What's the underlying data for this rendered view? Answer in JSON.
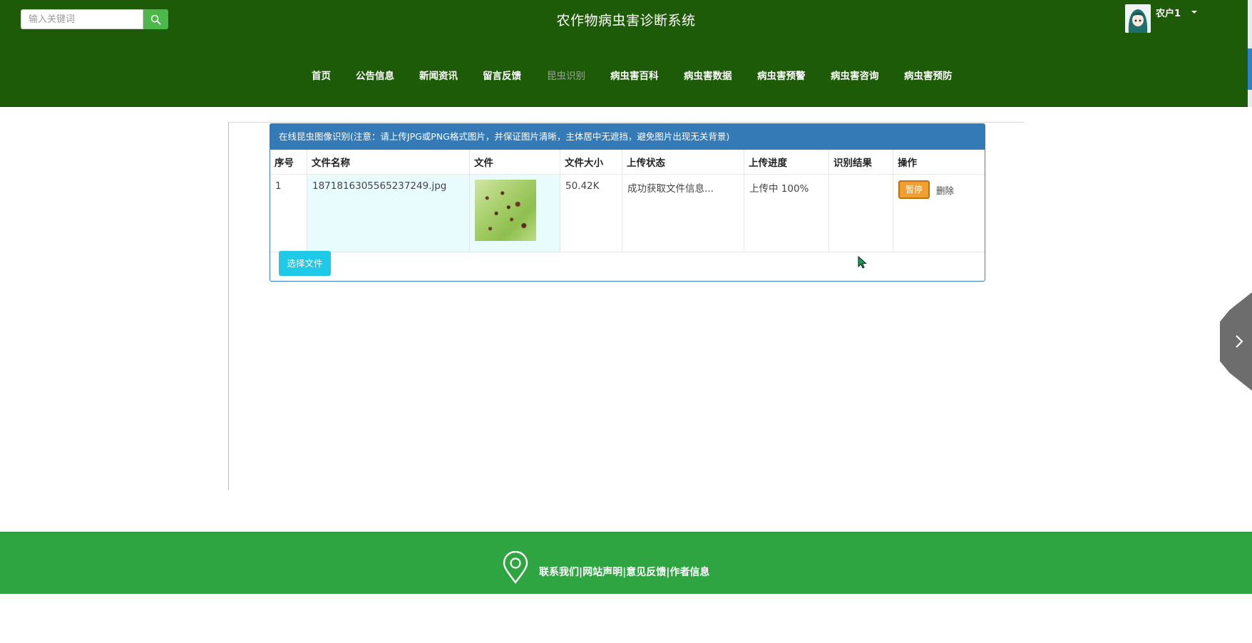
{
  "header": {
    "search_placeholder": "输入关键词",
    "site_title": "农作物病虫害诊断系统",
    "username": "农户1"
  },
  "nav": {
    "items": [
      "首页",
      "公告信息",
      "新闻资讯",
      "留言反馈",
      "昆虫识别",
      "病虫害百科",
      "病虫害数据",
      "病虫害预警",
      "病虫害咨询",
      "病虫害预防"
    ],
    "active": "昆虫识别"
  },
  "upload_panel": {
    "heading": "在线昆虫图像识别(注意：请上传JPG或PNG格式图片，并保证图片清晰，主体居中无遮挡，避免图片出现无关背景)",
    "columns": [
      "序号",
      "文件名称",
      "文件",
      "文件大小",
      "上传状态",
      "上传进度",
      "识别结果",
      "操作"
    ],
    "rows": [
      {
        "index": "1",
        "file_name": "1871816305565237249.jpg",
        "file_size": "50.42K",
        "status": "成功获取文件信息...",
        "progress": "上传中 100%",
        "result": "",
        "pause_label": "暂停",
        "delete_label": "删除"
      }
    ],
    "select_button": "选择文件"
  },
  "footer": {
    "links_text": "联系我们|网站声明|意见反馈|作者信息"
  },
  "colors": {
    "header_bg": "#1e5b08",
    "footer_bg": "#2ea541",
    "panel_heading": "#337ab7",
    "select_button": "#1fc9e8",
    "pause_button": "#f0a030"
  }
}
